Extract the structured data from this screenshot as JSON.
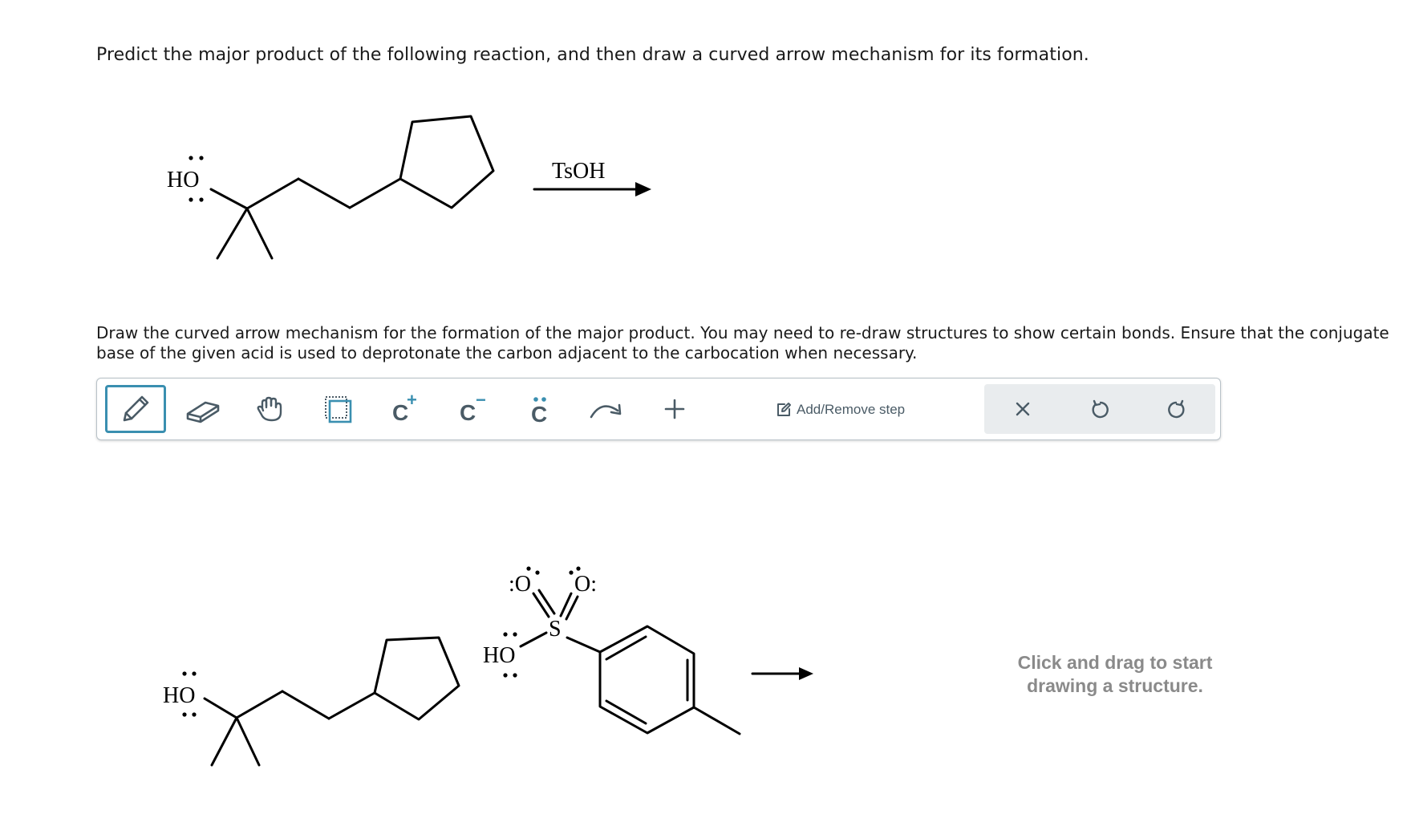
{
  "question": "Predict the major product of the following reaction, and then draw a curved arrow mechanism for its formation.",
  "instructions": "Draw the curved arrow mechanism for the formation of the major product. You may need to re-draw structures to show certain bonds. Ensure that the conjugate base of the given acid is used to deprotonate the carbon adjacent to the carbocation when necessary.",
  "reaction": {
    "reactant_label": "HO",
    "reagent": "TsOH"
  },
  "toolbar": {
    "tools": [
      {
        "name": "pencil-icon",
        "selected": true
      },
      {
        "name": "eraser-icon",
        "selected": false
      },
      {
        "name": "hand-icon",
        "selected": false
      },
      {
        "name": "selection-icon",
        "selected": false
      },
      {
        "name": "carbocation-icon",
        "label": "C",
        "superscript": "+"
      },
      {
        "name": "carbanion-icon",
        "label": "C",
        "superscript": "−"
      },
      {
        "name": "lone-pair-icon",
        "label": "C"
      },
      {
        "name": "curved-arrow-icon"
      },
      {
        "name": "plus-icon"
      }
    ],
    "add_remove_step_label": "Add/Remove step",
    "actions": [
      "close-icon",
      "undo-icon",
      "redo-icon"
    ]
  },
  "canvas": {
    "alcohol_label": "HO",
    "acid_hydroxyl_label": "HO",
    "sulfur_label": "S",
    "oxygen_left_label": ":O",
    "oxygen_right_label": "O:",
    "hint_line1": "Click and drag to start",
    "hint_line2": "drawing a structure."
  },
  "colors": {
    "accent": "#3a8fb0",
    "icon": "#4a5b66",
    "hint": "#8a8a8a",
    "action_bg": "#e9ecee"
  }
}
